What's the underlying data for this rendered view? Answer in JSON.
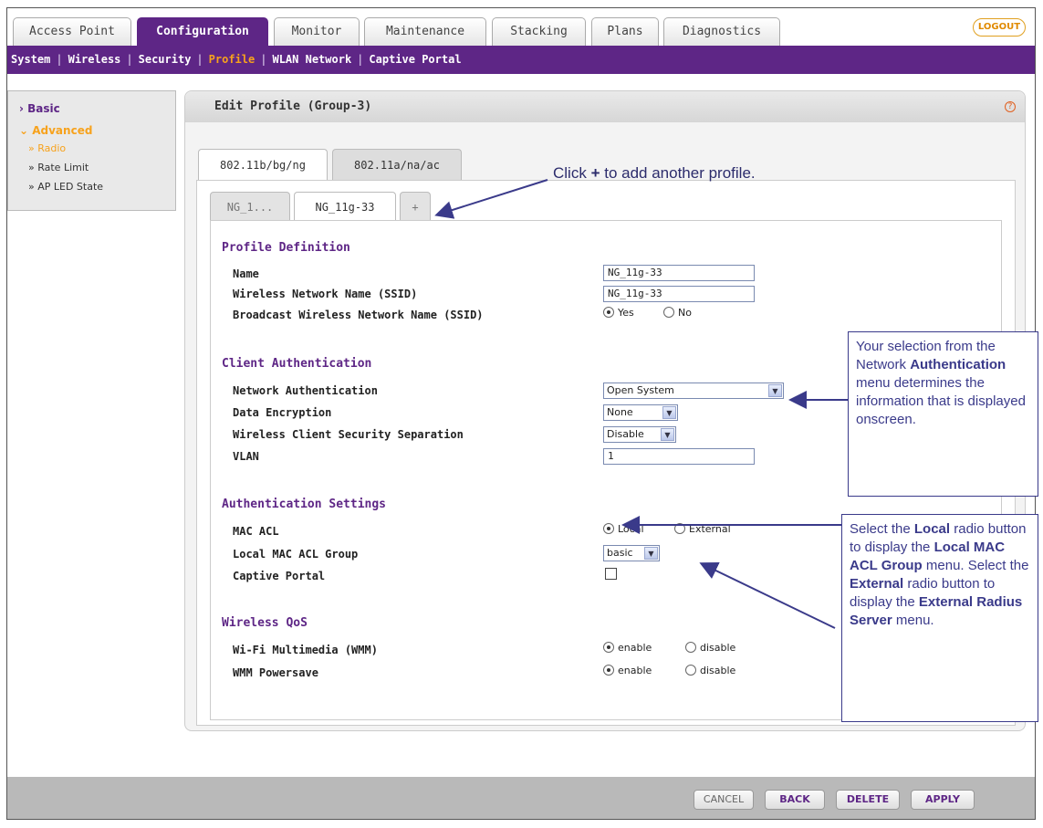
{
  "top_tabs": [
    "Access Point",
    "Configuration",
    "Monitor",
    "Maintenance",
    "Stacking",
    "Plans",
    "Diagnostics"
  ],
  "logout_label": "LOGOUT",
  "subnav": [
    "System",
    "Wireless",
    "Security",
    "Profile",
    "WLAN Network",
    "Captive Portal"
  ],
  "sidebar": {
    "basic": "Basic",
    "advanced": "Advanced",
    "sub_items": [
      "» Radio",
      "» Rate Limit",
      "» AP LED State"
    ]
  },
  "panel": {
    "title": "Edit Profile (Group-3)",
    "help_icon": "?",
    "band_tabs": [
      "802.11b/bg/ng",
      "802.11a/na/ac"
    ],
    "profile_tabs": [
      "NG_1...",
      "NG_11g-33",
      "+"
    ]
  },
  "form": {
    "profile_definition": {
      "heading": "Profile Definition",
      "name_label": "Name",
      "name_value": "NG_11g-33",
      "ssid_label": "Wireless Network Name (SSID)",
      "ssid_value": "NG_11g-33",
      "broadcast_label": "Broadcast Wireless Network Name (SSID)",
      "broadcast_yes": "Yes",
      "broadcast_no": "No"
    },
    "client_auth": {
      "heading": "Client Authentication",
      "network_auth_label": "Network Authentication",
      "network_auth_value": "Open System",
      "data_enc_label": "Data Encryption",
      "data_enc_value": "None",
      "separation_label": "Wireless Client Security Separation",
      "separation_value": "Disable",
      "vlan_label": "VLAN",
      "vlan_value": "1"
    },
    "auth_settings": {
      "heading": "Authentication Settings",
      "mac_acl_label": "MAC ACL",
      "mac_local": "Local",
      "mac_external": "External",
      "local_group_label": "Local MAC ACL Group",
      "local_group_value": "basic",
      "captive_label": "Captive Portal"
    },
    "qos": {
      "heading": "Wireless QoS",
      "wmm_label": "Wi-Fi Multimedia (WMM)",
      "wmm_enable": "enable",
      "wmm_disable": "disable",
      "powersave_label": "WMM Powersave",
      "ps_enable": "enable",
      "ps_disable": "disable"
    }
  },
  "buttons": [
    "CANCEL",
    "BACK",
    "DELETE",
    "APPLY"
  ],
  "callouts": {
    "add_profile": {
      "pre": "Click ",
      "bold": "+",
      "post": " to add another profile."
    },
    "network_auth": {
      "t1": "Your selection from the Network ",
      "b1": "Authentication",
      "t2": " menu determines the information that is displayed onscreen."
    },
    "local_external": {
      "t1": "Select the ",
      "b1": "Local",
      "t2": " radio button to display the ",
      "b2": "Local MAC ACL Group",
      "t3": " menu. Select the ",
      "b3": "External",
      "t4": " radio button to display the ",
      "b4": "External Radius Server",
      "t5": " menu."
    }
  }
}
